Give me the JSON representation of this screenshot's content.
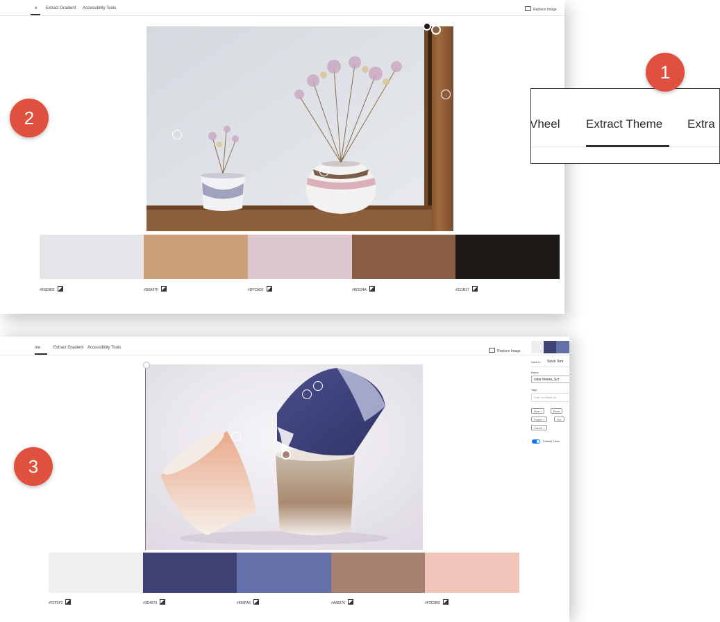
{
  "callouts": {
    "one": "1",
    "two": "2",
    "three": "3"
  },
  "zoom_tabs": {
    "left": "Vheel",
    "center": "Extract Theme",
    "right": "Extra"
  },
  "panel1": {
    "tabs": [
      "e",
      "Extract Gradient",
      "Accessibility Tools"
    ],
    "replace_label": "Replace Image",
    "swatches": [
      {
        "hex": "#E6E9EE",
        "color": "#e6e6ea"
      },
      {
        "hex": "#D0A97F",
        "color": "#cda07a"
      },
      {
        "hex": "#DFCAD1",
        "color": "#dec7ce"
      },
      {
        "hex": "#8C634A",
        "color": "#8a5d47"
      },
      {
        "hex": "#211B17",
        "color": "#201a16"
      }
    ]
  },
  "panel2": {
    "tabs": [
      "me",
      "Extract Gradient",
      "Accessibility Tools"
    ],
    "replace_label": "Replace Image",
    "swatches": [
      {
        "hex": "#F2F2F2",
        "color": "#f0f0f0"
      },
      {
        "hex": "#3D4573",
        "color": "#3d4273"
      },
      {
        "hex": "#656FA6",
        "color": "#6470aa"
      },
      {
        "hex": "#A68376",
        "color": "#a48170"
      },
      {
        "hex": "#F2C5BD",
        "color": "#f0c5b9"
      }
    ]
  },
  "side_panel": {
    "save_to": "Save to",
    "save_target": "Stock Tem",
    "name_label": "Name",
    "name_value": "color theme_Scr",
    "tags_label": "Tags",
    "tags_placeholder": "Enter or Select fro",
    "chips": [
      "Blue",
      "Brow",
      "Purple",
      "Gre",
      "Cream"
    ],
    "publish": "Publish Them",
    "swatch_colors": [
      "#eeeeee",
      "#3d4273",
      "#6470aa"
    ]
  }
}
